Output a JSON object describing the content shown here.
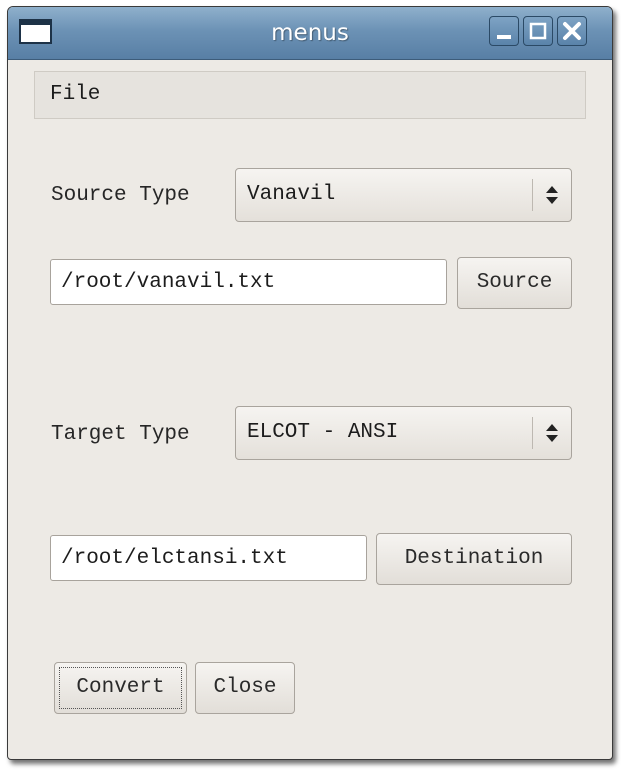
{
  "window": {
    "title": "menus"
  },
  "menubar": {
    "items": [
      {
        "label": "File"
      }
    ]
  },
  "source": {
    "type_label": "Source Type",
    "type_selected": "Vanavil",
    "path_value": "/root/vanavil.txt",
    "browse_label": "Source"
  },
  "target": {
    "type_label": "Target Type",
    "type_selected": "ELCOT - ANSI",
    "path_value": "/root/elctansi.txt",
    "browse_label": "Destination"
  },
  "actions": {
    "convert_label": "Convert",
    "close_label": "Close"
  },
  "icons": {
    "window_icon": "window-icon",
    "minimize": "minimize-icon",
    "maximize": "maximize-icon",
    "close": "close-icon",
    "combo_arrow": "updown-arrows-icon"
  },
  "colors": {
    "titlebar": "#6c92b5",
    "window_bg": "#edeae5"
  }
}
